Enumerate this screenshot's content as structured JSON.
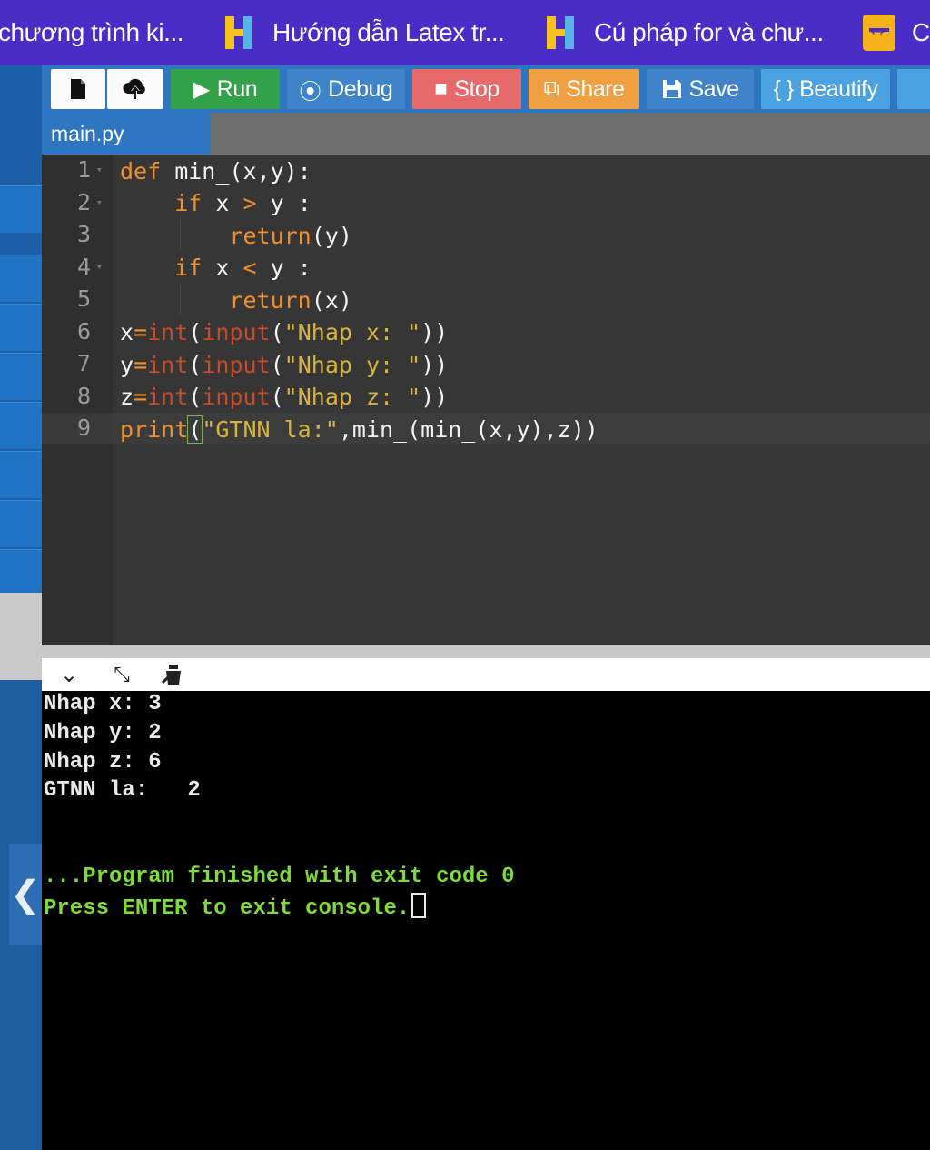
{
  "browser": {
    "tabs": [
      {
        "title": "chương trình ki...",
        "favicon": "none"
      },
      {
        "title": "Hướng dẫn Latex tr...",
        "favicon": "h-logo-icon"
      },
      {
        "title": "Cú pháp for và chư...",
        "favicon": "h-logo-icon"
      },
      {
        "title": "C",
        "favicon": "arrows-icon"
      }
    ],
    "colors": {
      "tabbar": "#4a2cc6"
    }
  },
  "toolbar": {
    "new_file_icon": "file-icon",
    "upload_icon": "cloud-upload-icon",
    "run": {
      "label": "Run",
      "icon": "play-icon",
      "color": "#33a04a"
    },
    "debug": {
      "label": "Debug",
      "icon": "debug-icon",
      "color": "#3f84c8"
    },
    "stop": {
      "label": "Stop",
      "icon": "stop-icon",
      "color": "#e8696a"
    },
    "share": {
      "label": "Share",
      "icon": "share-icon",
      "color": "#f0a040"
    },
    "save": {
      "label": "Save",
      "icon": "save-icon",
      "color": "#3f84c8"
    },
    "beautify": {
      "label": "{ } Beautify",
      "color": "#4aa2e0"
    }
  },
  "file_tab": {
    "name": "main.py"
  },
  "editor": {
    "line_numbers": [
      "1",
      "2",
      "3",
      "4",
      "5",
      "6",
      "7",
      "8",
      "9"
    ],
    "lines": [
      [
        {
          "t": "def",
          "c": "kw"
        },
        {
          "t": " min_(x,y):",
          "c": ""
        }
      ],
      [
        {
          "t": "    ",
          "c": ""
        },
        {
          "t": "if",
          "c": "kw"
        },
        {
          "t": " x ",
          "c": ""
        },
        {
          "t": ">",
          "c": "op"
        },
        {
          "t": " y :",
          "c": ""
        }
      ],
      [
        {
          "t": "        ",
          "c": ""
        },
        {
          "t": "return",
          "c": "kw"
        },
        {
          "t": "(y)",
          "c": ""
        }
      ],
      [
        {
          "t": "    ",
          "c": ""
        },
        {
          "t": "if",
          "c": "kw"
        },
        {
          "t": " x ",
          "c": ""
        },
        {
          "t": "<",
          "c": "op"
        },
        {
          "t": " y :",
          "c": ""
        }
      ],
      [
        {
          "t": "        ",
          "c": ""
        },
        {
          "t": "return",
          "c": "kw"
        },
        {
          "t": "(x)",
          "c": ""
        }
      ],
      [
        {
          "t": "x",
          "c": ""
        },
        {
          "t": "=",
          "c": "op"
        },
        {
          "t": "int",
          "c": "bi"
        },
        {
          "t": "(",
          "c": ""
        },
        {
          "t": "input",
          "c": "bi"
        },
        {
          "t": "(",
          "c": ""
        },
        {
          "t": "\"Nhap x: \"",
          "c": "st"
        },
        {
          "t": "))",
          "c": ""
        }
      ],
      [
        {
          "t": "y",
          "c": ""
        },
        {
          "t": "=",
          "c": "op"
        },
        {
          "t": "int",
          "c": "bi"
        },
        {
          "t": "(",
          "c": ""
        },
        {
          "t": "input",
          "c": "bi"
        },
        {
          "t": "(",
          "c": ""
        },
        {
          "t": "\"Nhap y: \"",
          "c": "st"
        },
        {
          "t": "))",
          "c": ""
        }
      ],
      [
        {
          "t": "z",
          "c": ""
        },
        {
          "t": "=",
          "c": "op"
        },
        {
          "t": "int",
          "c": "bi"
        },
        {
          "t": "(",
          "c": ""
        },
        {
          "t": "input",
          "c": "bi"
        },
        {
          "t": "(",
          "c": ""
        },
        {
          "t": "\"Nhap z: \"",
          "c": "st"
        },
        {
          "t": "))",
          "c": ""
        }
      ],
      [
        {
          "t": "print",
          "c": "kw"
        },
        {
          "t": "(",
          "c": "hl"
        },
        {
          "t": "\"GTNN la:\"",
          "c": "st"
        },
        {
          "t": ",min_(min_(x,y),z))",
          "c": ""
        }
      ]
    ],
    "active_line": 9
  },
  "console": {
    "output": [
      "Nhap x: 3",
      "Nhap y: 2",
      "Nhap z: 6",
      "GTNN la:   2"
    ],
    "finished": "...Program finished with exit code 0",
    "prompt": "Press ENTER to exit console."
  }
}
